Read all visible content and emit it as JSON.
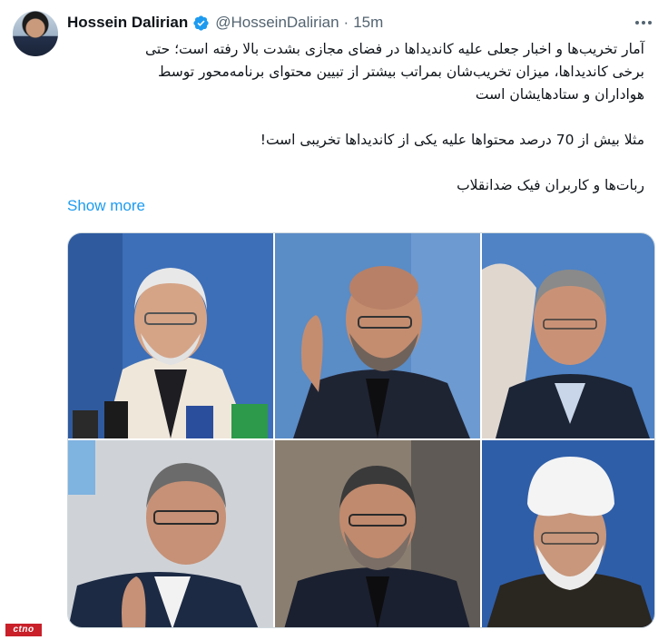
{
  "author": {
    "name": "Hossein Dalirian",
    "handle": "@HosseinDalirian",
    "separator": "·",
    "time": "15m"
  },
  "tweet": {
    "line1": "آمار تخریب‌ها و اخبار جعلی علیه کاندیداها در فضای مجازی بشدت بالا رفته است؛ حتی",
    "line2": "برخی کاندیداها، میزان تخریب‌شان بمراتب بیشتر از تبیین محتوای برنامه‌محور توسط",
    "line3": "هواداران و ستادهایشان است",
    "line4": "مثلا بیش از 70 درصد محتواها علیه یکی از کاندیداها تخریبی است!",
    "line5": "ربات‌ها و کاربران فیک ضدانقلاب",
    "show_more": "Show more"
  },
  "icons": {
    "verified": "verified-badge-icon",
    "more": "more-options-icon"
  },
  "colors": {
    "link": "#1d9bf0",
    "verified": "#1d9bf0",
    "secondary_text": "#536471",
    "watermark": "#c9202a"
  },
  "watermark": {
    "text": "ctno"
  },
  "photos": [
    "candidate-photo-1",
    "candidate-photo-2",
    "candidate-photo-3",
    "candidate-photo-4",
    "candidate-photo-5",
    "candidate-photo-6"
  ]
}
